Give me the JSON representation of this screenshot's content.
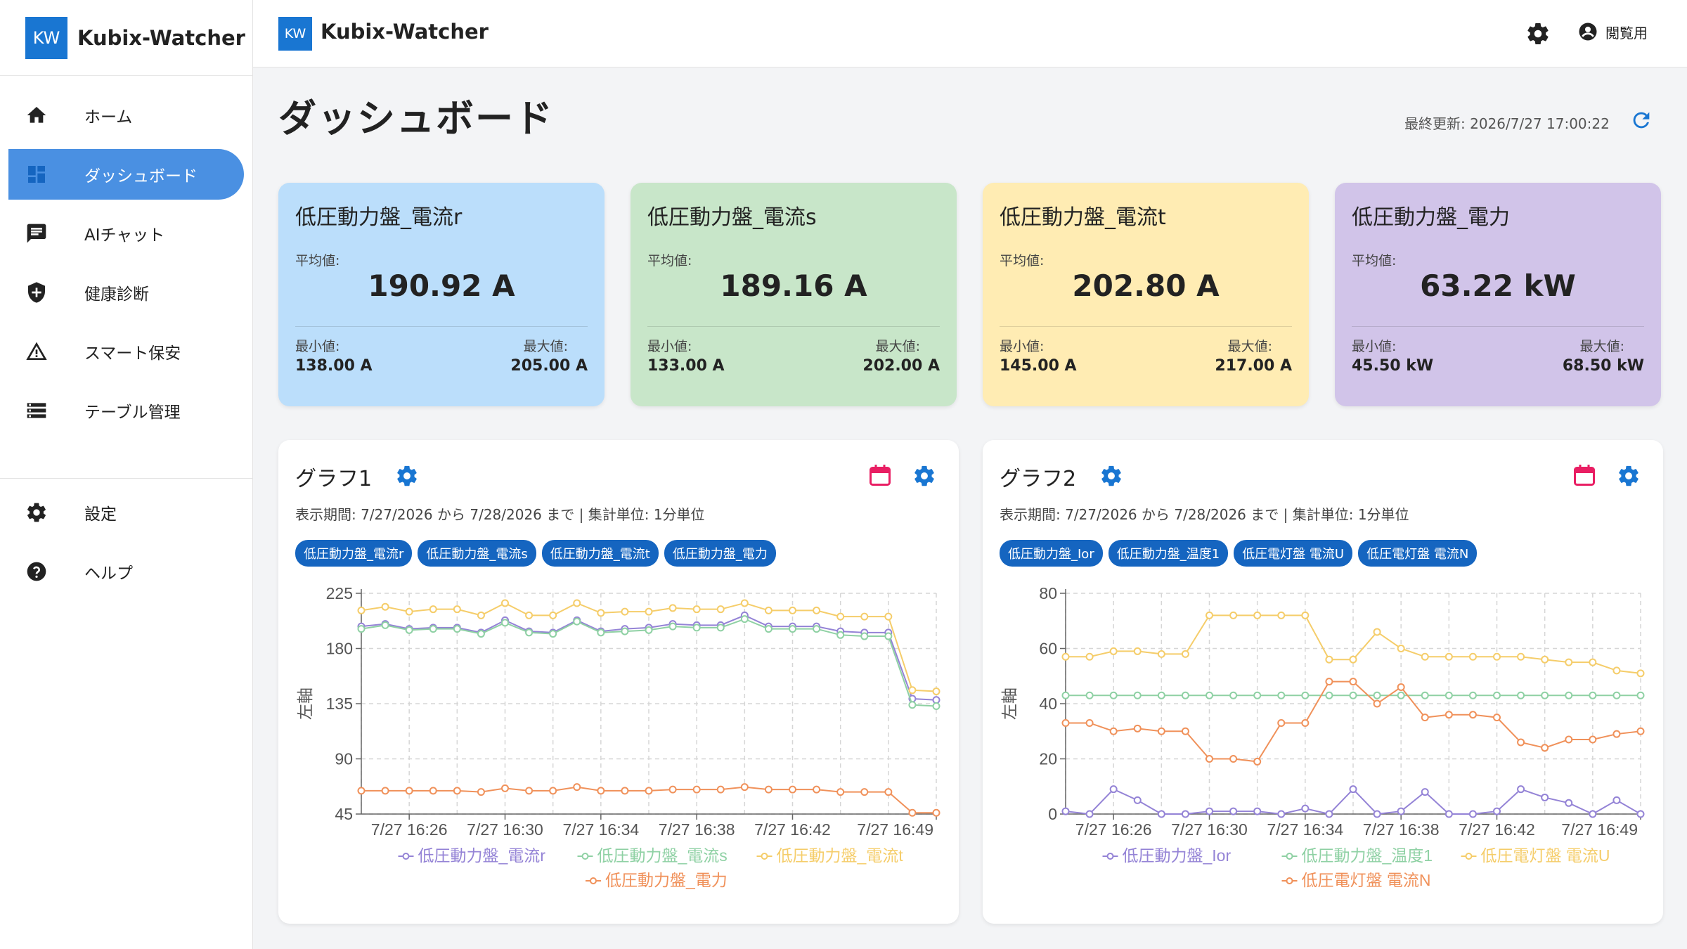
{
  "app": {
    "logo": "KW",
    "name": "Kubix-Watcher"
  },
  "sidebar": {
    "items": [
      {
        "label": "ホーム",
        "icon": "home-icon"
      },
      {
        "label": "ダッシュボード",
        "icon": "dashboard-icon",
        "active": true
      },
      {
        "label": "AIチャット",
        "icon": "chat-icon"
      },
      {
        "label": "健康診断",
        "icon": "shield-plus-icon"
      },
      {
        "label": "スマート保安",
        "icon": "warning-icon"
      },
      {
        "label": "テーブル管理",
        "icon": "table-list-icon"
      }
    ],
    "bottom_items": [
      {
        "label": "設定",
        "icon": "gear-icon"
      },
      {
        "label": "ヘルプ",
        "icon": "help-icon"
      }
    ]
  },
  "topbar": {
    "logo": "KW",
    "title": "Kubix-Watcher",
    "user_label": "閲覧用"
  },
  "main": {
    "title": "ダッシュボード",
    "last_update": "最終更新: 2026/7/27 17:00:22"
  },
  "kpis": [
    {
      "title": "低圧動力盤_電流r",
      "avg_label": "平均値:",
      "avg": "190.92 A",
      "min_label": "最小値:",
      "min": "138.00 A",
      "max_label": "最大値:",
      "max": "205.00 A",
      "color": "#bbdefb"
    },
    {
      "title": "低圧動力盤_電流s",
      "avg_label": "平均値:",
      "avg": "189.16 A",
      "min_label": "最小値:",
      "min": "133.00 A",
      "max_label": "最大値:",
      "max": "202.00 A",
      "color": "#c8e6c9"
    },
    {
      "title": "低圧動力盤_電流t",
      "avg_label": "平均値:",
      "avg": "202.80 A",
      "min_label": "最小値:",
      "min": "145.00 A",
      "max_label": "最大値:",
      "max": "217.00 A",
      "color": "#ffecb3"
    },
    {
      "title": "低圧動力盤_電力",
      "avg_label": "平均値:",
      "avg": "63.22 kW",
      "min_label": "最小値:",
      "min": "45.50 kW",
      "max_label": "最大値:",
      "max": "68.50 kW",
      "color": "#d1c4e9"
    }
  ],
  "graphs": [
    {
      "title": "グラフ1",
      "period": "表示期間: 7/27/2026 から 7/28/2026 まで | 集計単位: 1分単位",
      "chips": [
        "低圧動力盤_電流r",
        "低圧動力盤_電流s",
        "低圧動力盤_電流t",
        "低圧動力盤_電力"
      ]
    },
    {
      "title": "グラフ2",
      "period": "表示期間: 7/27/2026 から 7/28/2026 まで | 集計単位: 1分単位",
      "chips": [
        "低圧動力盤_Ior",
        "低圧動力盤_温度1",
        "低圧電灯盤 電流U",
        "低圧電灯盤 電流N"
      ]
    }
  ],
  "chart_data": [
    {
      "type": "line",
      "ylabel": "左軸",
      "ylim": [
        45,
        225
      ],
      "yticks": [
        45,
        90,
        135,
        180,
        225
      ],
      "xticks": [
        "7/27 16:26",
        "7/27 16:30",
        "7/27 16:34",
        "7/27 16:38",
        "7/27 16:42",
        "7/27 16:49"
      ],
      "grid": true,
      "legend_position": "bottom",
      "series": [
        {
          "name": "低圧動力盤_電流r",
          "color": "#9483d6",
          "values": [
            198,
            200,
            196,
            197,
            197,
            193,
            203,
            194,
            193,
            203,
            194,
            196,
            197,
            200,
            199,
            199,
            207,
            198,
            198,
            198,
            194,
            193,
            193,
            139,
            138
          ]
        },
        {
          "name": "低圧動力盤_電流s",
          "color": "#8fd1a4",
          "values": [
            196,
            199,
            195,
            196,
            196,
            192,
            201,
            193,
            192,
            202,
            193,
            194,
            195,
            198,
            197,
            197,
            204,
            196,
            196,
            196,
            191,
            190,
            190,
            134,
            133
          ]
        },
        {
          "name": "低圧動力盤_電流t",
          "color": "#f5cd6a",
          "values": [
            211,
            214,
            210,
            212,
            212,
            207,
            217,
            207,
            207,
            217,
            209,
            210,
            210,
            213,
            212,
            212,
            217,
            211,
            211,
            211,
            206,
            206,
            206,
            146,
            145
          ]
        },
        {
          "name": "低圧動力盤_電力",
          "color": "#f0915a",
          "values": [
            64,
            64,
            64,
            64,
            64,
            63,
            66,
            64,
            64,
            67,
            64,
            64,
            64,
            65,
            65,
            65,
            67,
            65,
            65,
            65,
            63,
            63,
            63,
            46,
            46
          ]
        }
      ]
    },
    {
      "type": "line",
      "ylabel": "左軸",
      "ylim": [
        0,
        80
      ],
      "yticks": [
        0,
        20,
        40,
        60,
        80
      ],
      "xticks": [
        "7/27 16:26",
        "7/27 16:30",
        "7/27 16:34",
        "7/27 16:38",
        "7/27 16:42",
        "7/27 16:49"
      ],
      "grid": true,
      "legend_position": "bottom",
      "series": [
        {
          "name": "低圧動力盤_Ior",
          "color": "#9483d6",
          "values": [
            1,
            0,
            9,
            5,
            0,
            0,
            1,
            1,
            1,
            0,
            2,
            0,
            9,
            0,
            1,
            8,
            0,
            0,
            1,
            9,
            6,
            4,
            0,
            5,
            0
          ]
        },
        {
          "name": "低圧動力盤_温度1",
          "color": "#8fd1a4",
          "values": [
            43,
            43,
            43,
            43,
            43,
            43,
            43,
            43,
            43,
            43,
            43,
            43,
            43,
            43,
            43,
            43,
            43,
            43,
            43,
            43,
            43,
            43,
            43,
            43,
            43
          ]
        },
        {
          "name": "低圧電灯盤 電流U",
          "color": "#f5cd6a",
          "values": [
            57,
            57,
            59,
            59,
            58,
            58,
            72,
            72,
            72,
            72,
            72,
            56,
            56,
            66,
            60,
            57,
            57,
            57,
            57,
            57,
            56,
            55,
            55,
            52,
            51
          ]
        },
        {
          "name": "低圧電灯盤 電流N",
          "color": "#f0915a",
          "values": [
            33,
            33,
            30,
            31,
            30,
            30,
            20,
            20,
            19,
            33,
            33,
            48,
            48,
            40,
            46,
            35,
            36,
            36,
            35,
            26,
            24,
            27,
            27,
            29,
            30
          ]
        }
      ]
    }
  ]
}
